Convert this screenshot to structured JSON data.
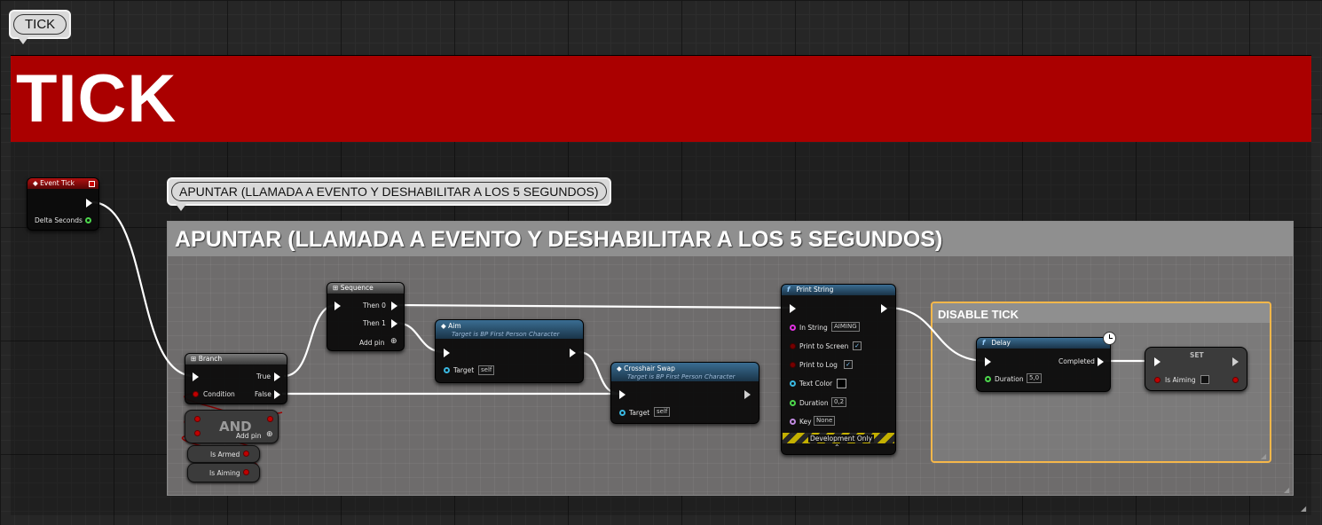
{
  "tick_bubble": "TICK",
  "tick_header": "TICK",
  "apuntar_bubble": "APUNTAR (LLAMADA A EVENTO Y DESHABILITAR A LOS 5 SEGUNDOS)",
  "apuntar_header": "APUNTAR (LLAMADA A EVENTO Y DESHABILITAR A LOS 5 SEGUNDOS)",
  "disable_header": "DISABLE TICK",
  "event_tick": {
    "title": "Event Tick",
    "delta": "Delta Seconds"
  },
  "branch": {
    "title": "Branch",
    "true": "True",
    "condition": "Condition",
    "false": "False"
  },
  "and_node": {
    "title": "AND",
    "add_pin": "Add pin"
  },
  "is_armed": "Is Armed",
  "is_aiming_get": "Is Aiming",
  "sequence": {
    "title": "Sequence",
    "then0": "Then 0",
    "then1": "Then 1",
    "add_pin": "Add pin"
  },
  "aim": {
    "title": "Aim",
    "subtitle": "Target is BP First Person Character",
    "target": "Target",
    "target_value": "self"
  },
  "crosshair": {
    "title": "Crosshair Swap",
    "subtitle": "Target is BP First Person Character",
    "target": "Target",
    "target_value": "self"
  },
  "print_string": {
    "title": "Print String",
    "in_string": "In String",
    "in_string_value": "AIMING",
    "print_screen": "Print to Screen",
    "print_log": "Print to Log",
    "text_color": "Text Color",
    "duration": "Duration",
    "duration_value": "0,2",
    "key": "Key",
    "key_value": "None",
    "dev_only": "Development Only",
    "check": "✓"
  },
  "delay": {
    "title": "Delay",
    "completed": "Completed",
    "duration": "Duration",
    "duration_value": "5,0"
  },
  "set_node": {
    "title": "SET",
    "is_aiming": "Is Aiming"
  },
  "colors": {
    "tick_comment": "#aa0000",
    "apuntar_comment": "#8c8c8c",
    "disable_border": "#f5b74a"
  }
}
